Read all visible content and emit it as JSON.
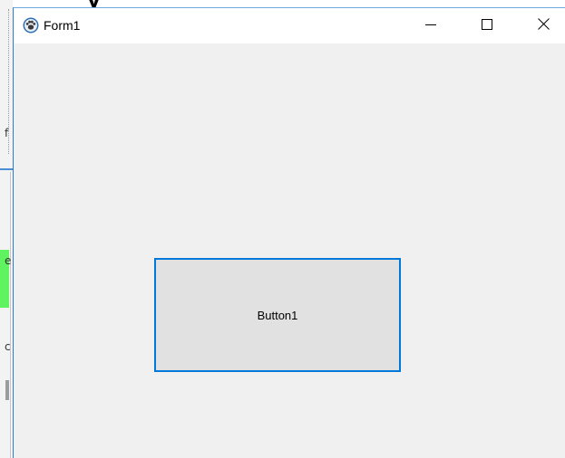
{
  "window": {
    "title": "Form1"
  },
  "titlebar_icons": {
    "app": "paw-icon",
    "minimize": "minimize-icon",
    "maximize": "maximize-icon",
    "close": "close-icon"
  },
  "form": {
    "button1_label": "Button1"
  },
  "colors": {
    "button_border": "#0078d7",
    "button_bg": "#e1e1e1",
    "form_bg": "#f0f0f0",
    "titlebar_bg": "#ffffff"
  }
}
